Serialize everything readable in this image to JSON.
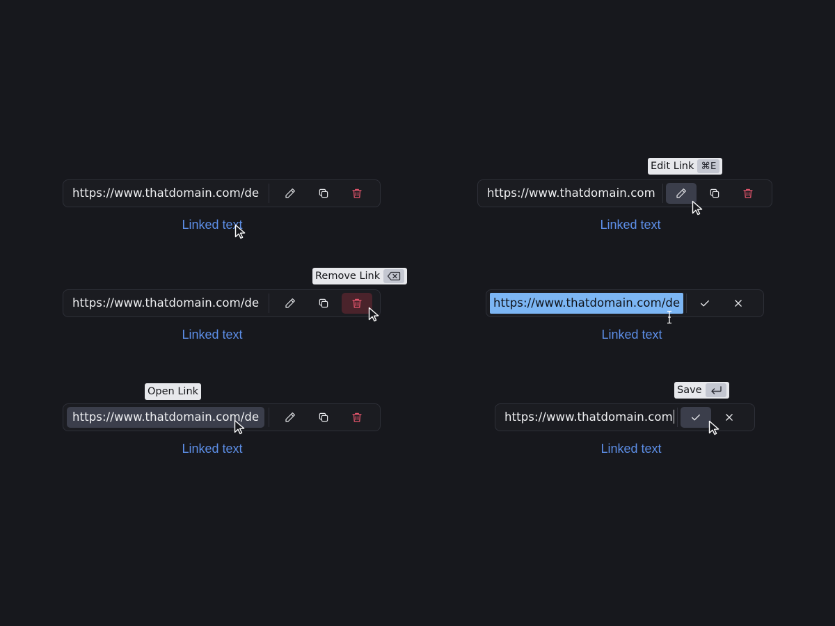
{
  "linked_text": "Linked text",
  "url_full": "https://www.thatdomain.com/de",
  "url_short": "https://www.thatdomain.com",
  "tooltips": {
    "edit": {
      "label": "Edit Link",
      "shortcut": "⌘E"
    },
    "remove": {
      "label": "Remove Link",
      "shortcut_icon": "backspace-icon"
    },
    "open": {
      "label": "Open Link"
    },
    "save": {
      "label": "Save",
      "shortcut_icon": "enter-icon"
    }
  },
  "icons": {
    "edit": "pencil-icon",
    "copy": "copy-icon",
    "delete": "trash-icon",
    "confirm": "check-icon",
    "cancel": "close-icon",
    "pointer": "cursor-arrow-icon",
    "text_cursor": "text-cursor-icon"
  },
  "colors": {
    "background": "#17181d",
    "toolbar": "#1b1c21",
    "border": "#2e3038",
    "link": "#5d8fe8",
    "danger": "#e5556c",
    "selection": "#7cb6f4",
    "hover": "#3b3e4b",
    "tooltip": "#e7e8ec"
  }
}
